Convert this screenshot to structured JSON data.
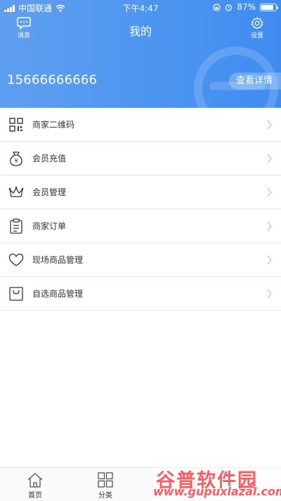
{
  "status_bar": {
    "carrier": "中国联通",
    "time": "下午4:47",
    "battery_percent": "87%",
    "battery_level": 0.87
  },
  "header": {
    "title": "我的",
    "left_button_label": "消息",
    "right_button_label": "设置",
    "phone": "15666666666",
    "detail_button_label": "查看详情",
    "gradient_start": "#5f9ff0",
    "gradient_end": "#3f8cf0"
  },
  "menu": {
    "items": [
      {
        "label": "商家二维码",
        "icon": "qrcode-icon"
      },
      {
        "label": "会员充值",
        "icon": "money-bag-icon"
      },
      {
        "label": "会员管理",
        "icon": "crown-icon"
      },
      {
        "label": "商家订单",
        "icon": "clipboard-icon"
      },
      {
        "label": "现场商品管理",
        "icon": "heart-icon"
      },
      {
        "label": "自选商品管理",
        "icon": "shopping-bag-icon"
      }
    ]
  },
  "tabbar": {
    "tabs": [
      {
        "label": "首页",
        "icon": "home-icon"
      },
      {
        "label": "分类",
        "icon": "grid-icon"
      }
    ]
  },
  "watermark": {
    "text": "谷普软件园",
    "url": "www.gupuxlazal.com",
    "color": "#ff5a5f"
  }
}
